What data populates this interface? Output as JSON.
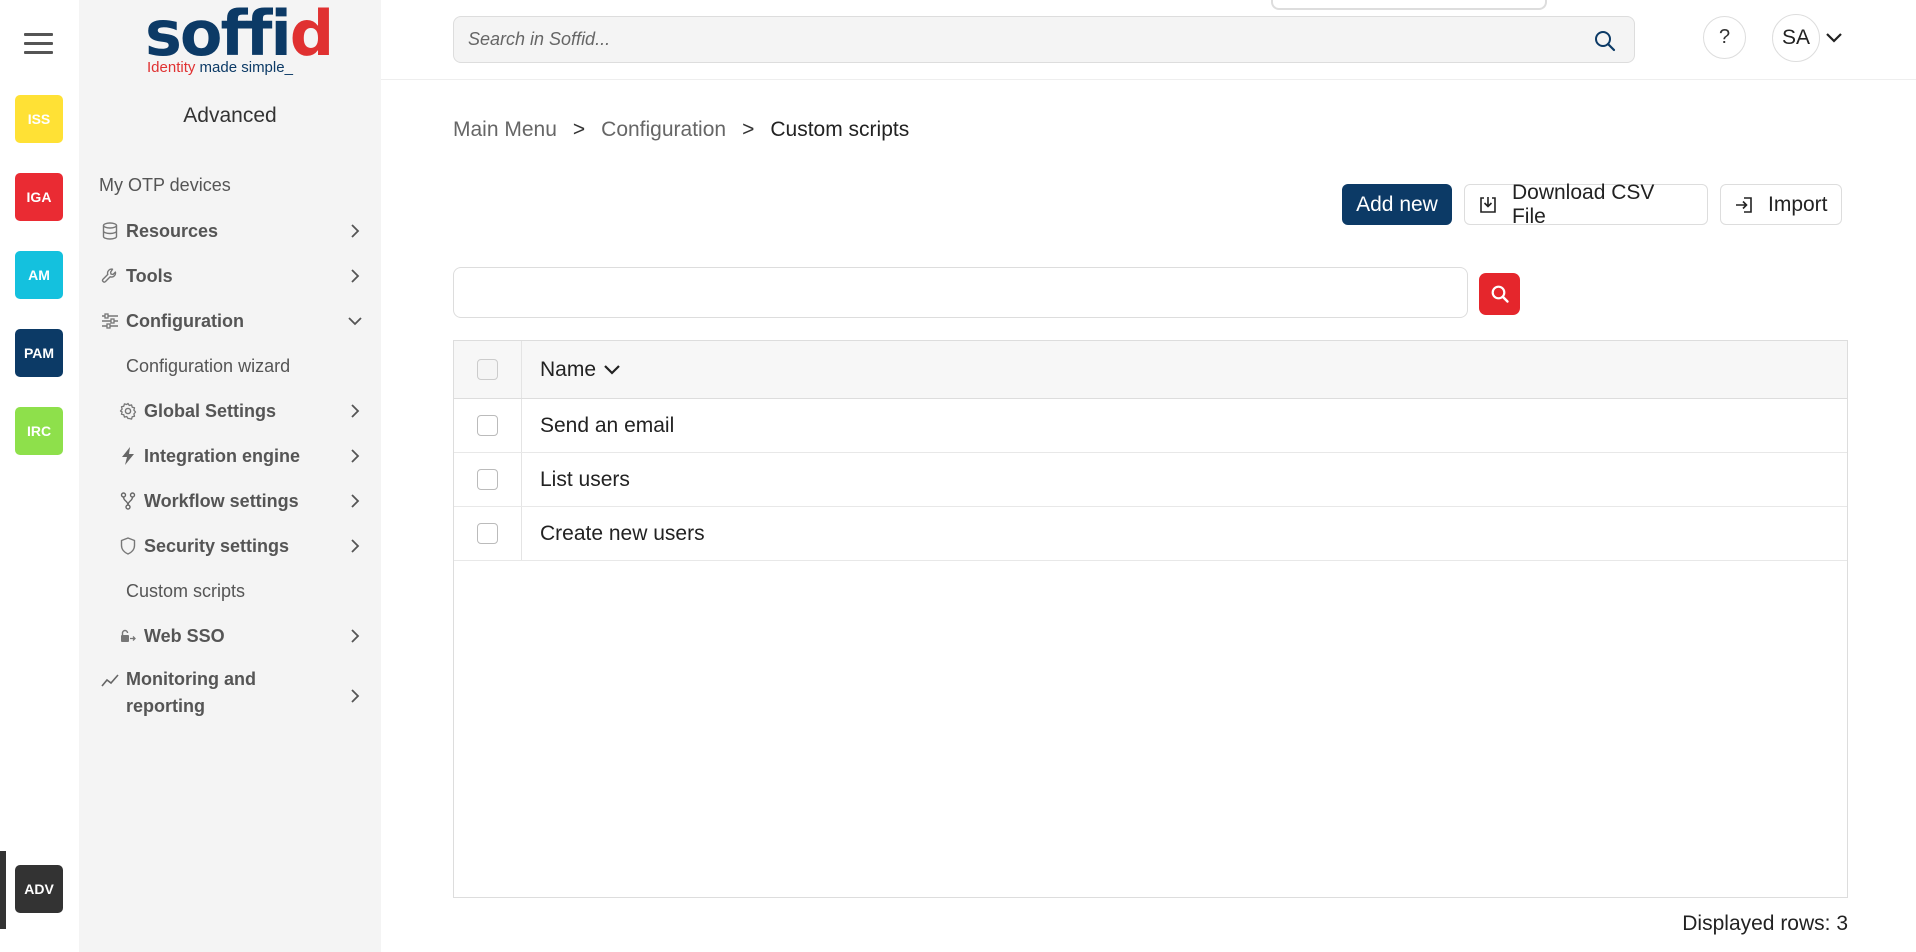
{
  "rail": {
    "apps": [
      {
        "label": "ISS",
        "color": "#ffe135",
        "text_color": "#fff"
      },
      {
        "label": "IGA",
        "color": "#ea2b33",
        "text_color": "#fff"
      },
      {
        "label": "AM",
        "color": "#14c1de",
        "text_color": "#fff"
      },
      {
        "label": "PAM",
        "color": "#0c3a66",
        "text_color": "#fff"
      },
      {
        "label": "IRC",
        "color": "#8ee04b",
        "text_color": "#fff"
      }
    ],
    "active_app": {
      "label": "ADV",
      "color": "#333333"
    }
  },
  "sidebar": {
    "logo": {
      "word_a": "so",
      "word_b": "ff",
      "word_c": "i",
      "word_d": "d",
      "tag_a": "Identity",
      "tag_b": " made simple_"
    },
    "section_title": "Advanced",
    "items": [
      {
        "label": "My OTP devices"
      },
      {
        "label": "Resources",
        "icon": "database-icon"
      },
      {
        "label": "Tools",
        "icon": "wrench-icon"
      },
      {
        "label": "Configuration",
        "icon": "sliders-icon"
      },
      {
        "label": "Configuration wizard"
      },
      {
        "label": "Global Settings",
        "icon": "gear-icon"
      },
      {
        "label": "Integration engine",
        "icon": "lightning-icon"
      },
      {
        "label": "Workflow settings",
        "icon": "fork-icon"
      },
      {
        "label": "Security settings",
        "icon": "shield-icon"
      },
      {
        "label": "Custom scripts"
      },
      {
        "label": "Web SSO",
        "icon": "lock-arrow-icon"
      },
      {
        "label": "Monitoring and reporting",
        "icon": "trend-icon"
      }
    ]
  },
  "topbar": {
    "search_placeholder": "Search in Soffid...",
    "help_label": "?",
    "user_initials": "SA"
  },
  "breadcrumb": {
    "items": [
      "Main Menu",
      "Configuration",
      "Custom scripts"
    ],
    "separator": ">"
  },
  "actions": {
    "add_new": "Add new",
    "download_csv": "Download CSV File",
    "import": "Import"
  },
  "table": {
    "column_name": "Name",
    "rows": [
      "Send an email",
      "List users",
      "Create new users"
    ]
  },
  "footer": {
    "displayed_rows": "Displayed rows: 3"
  },
  "colors": {
    "primary": "#0c3a66",
    "danger": "#e5262c"
  }
}
